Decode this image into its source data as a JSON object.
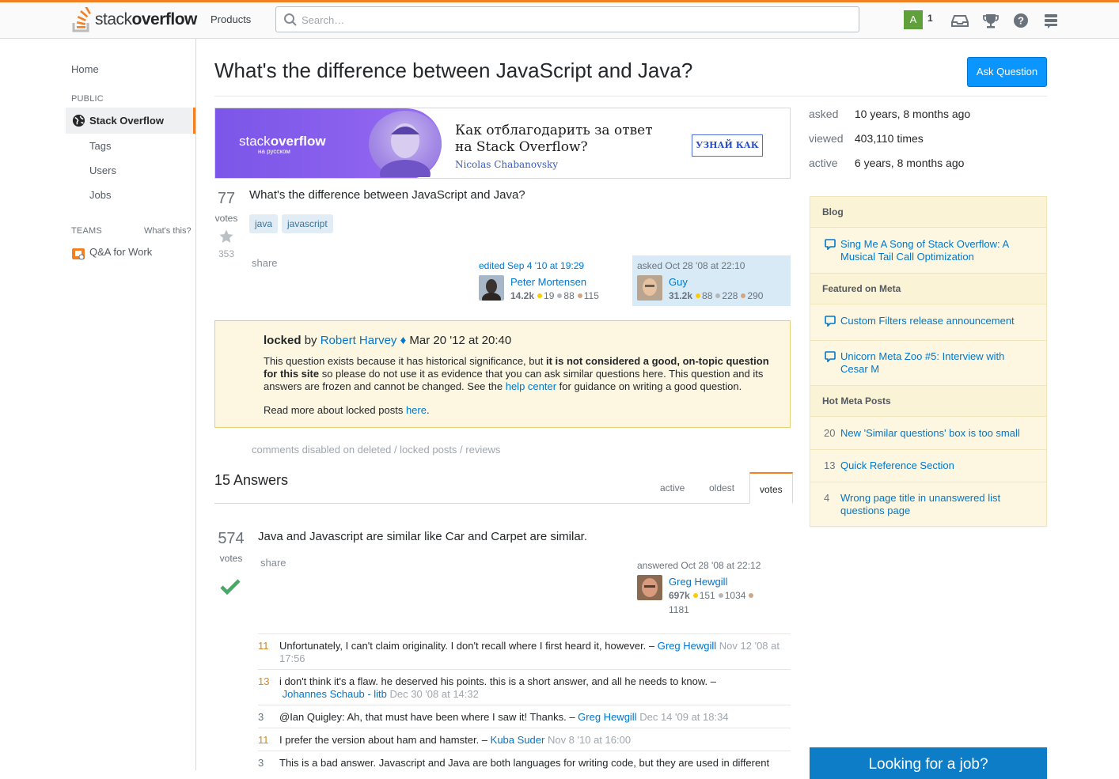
{
  "topbar": {
    "logo_light": "stack",
    "logo_bold": "overflow",
    "products": "Products",
    "search_placeholder": "Search…",
    "avatar_letter": "A",
    "reputation": "1"
  },
  "leftnav": {
    "home": "Home",
    "public": "PUBLIC",
    "stack_overflow": "Stack Overflow",
    "tags": "Tags",
    "users": "Users",
    "jobs": "Jobs",
    "teams": "TEAMS",
    "whats_this": "What's this?",
    "qa_for_work": "Q&A for Work"
  },
  "question": {
    "title": "What's the difference between JavaScript and Java?",
    "ask_button": "Ask Question",
    "votes": "77",
    "votes_label": "votes",
    "favorites": "353",
    "body": "What's the difference between JavaScript and Java?",
    "tags": [
      "java",
      "javascript"
    ],
    "share": "share",
    "edited": {
      "action": "edited Sep 4 '10 at 19:29",
      "user": "Peter Mortensen",
      "rep": "14.2k",
      "gold": "19",
      "silver": "88",
      "bronze": "115"
    },
    "asked": {
      "action": "asked Oct 28 '08 at 22:10",
      "user": "Guy",
      "rep": "31.2k",
      "gold": "88",
      "silver": "228",
      "bronze": "290"
    }
  },
  "banner": {
    "logo_light": "stack",
    "logo_bold": "overflow",
    "logo_sub": "на русском",
    "line1": "Как отблагодарить за ответ",
    "line2": "на Stack Overflow?",
    "author": "Nicolas Chabanovsky",
    "button": "УЗНАЙ КАК"
  },
  "locked": {
    "word": "locked",
    "by": "by",
    "moderator": "Robert Harvey",
    "diamond": "♦",
    "date": "Mar 20 '12 at 20:40",
    "p1_a": "This question exists because it has historical significance, but ",
    "p1_b": "it is not considered a good, on-topic question for this site",
    "p1_c": " so please do not use it as evidence that you can ask similar questions here. This question and its answers are frozen and cannot be changed. See the ",
    "help_link": "help center",
    "p1_d": " for guidance on writing a good question.",
    "more_a": "Read more about locked posts ",
    "more_link": "here",
    "more_b": "."
  },
  "comments_disabled": "comments disabled on deleted / locked posts / reviews",
  "answers": {
    "count_label": "15 Answers",
    "tabs": [
      "active",
      "oldest",
      "votes"
    ],
    "active_tab": "votes",
    "top": {
      "votes": "574",
      "votes_label": "votes",
      "body": "Java and Javascript are similar like Car and Carpet are similar.",
      "share": "share",
      "action": "answered Oct 28 '08 at 22:12",
      "user": "Greg Hewgill",
      "rep": "697k",
      "gold": "151",
      "silver": "1034",
      "bronze": "1181"
    },
    "comments": [
      {
        "score": "11",
        "text": "Unfortunately, I can't claim originality. I don't recall where I first heard it, however. – ",
        "user": "Greg Hewgill",
        "date": "Nov 12 '08 at 17:56"
      },
      {
        "score": "13",
        "text": "i don't think it's a flaw. he deserved his points. this is a short answer, and all he needs to know. – ",
        "user": "Johannes Schaub - litb",
        "date": "Dec 30 '08 at 14:32"
      },
      {
        "score": "3",
        "text": "@Ian Quigley: Ah, that must have been where I saw it! Thanks. – ",
        "user": "Greg Hewgill",
        "date": "Dec 14 '09 at 18:34"
      },
      {
        "score": "11",
        "text": "I prefer the version about ham and hamster. – ",
        "user": "Kuba Suder",
        "date": "Nov 8 '10 at 16:00"
      },
      {
        "score": "3",
        "text": "This is a bad answer. Javascript and Java are both languages for writing code, but they are used in different",
        "user": "",
        "date": ""
      }
    ]
  },
  "sidebar": {
    "asked_k": "asked",
    "asked_v": "10 years, 8 months ago",
    "viewed_k": "viewed",
    "viewed_v": "403,110 times",
    "active_k": "active",
    "active_v": "6 years, 8 months ago",
    "blog_head": "Blog",
    "blog_item": "Sing Me A Song of Stack Overflow: A Musical Tail Call Optimization",
    "meta_head": "Featured on Meta",
    "meta_item1": "Custom Filters release announcement",
    "meta_item2": "Unicorn Meta Zoo #5: Interview with Cesar M",
    "hot_head": "Hot Meta Posts",
    "hot": [
      {
        "num": "20",
        "title": "New 'Similar questions' box is too small"
      },
      {
        "num": "13",
        "title": "Quick Reference Section"
      },
      {
        "num": "4",
        "title": "Wrong page title in unanswered list questions page"
      }
    ],
    "job_banner": "Looking for a job?"
  },
  "colors": {
    "accent": "#f48024",
    "link": "#0077cc",
    "button": "#0a95ff"
  }
}
